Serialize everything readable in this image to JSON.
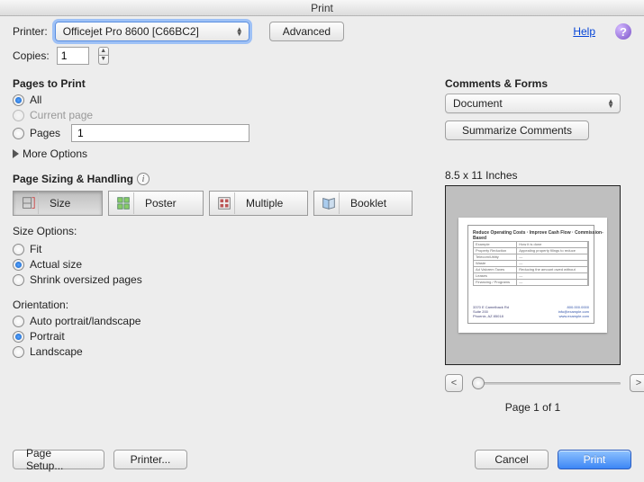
{
  "window": {
    "title": "Print"
  },
  "header": {
    "printer_label": "Printer:",
    "printer_value": "Officejet Pro 8600 [C66BC2]",
    "advanced_label": "Advanced",
    "help_link": "Help",
    "copies_label": "Copies:",
    "copies_value": "1"
  },
  "pages_to_print": {
    "heading": "Pages to Print",
    "options": {
      "all": "All",
      "current": "Current page",
      "pages": "Pages",
      "pages_value": "1"
    },
    "selected": "all",
    "more_options": "More Options"
  },
  "sizing": {
    "heading": "Page Sizing & Handling",
    "tabs": {
      "size": "Size",
      "poster": "Poster",
      "multiple": "Multiple",
      "booklet": "Booklet"
    },
    "selected_tab": "size",
    "size_options_label": "Size Options:",
    "options": {
      "fit": "Fit",
      "actual": "Actual size",
      "shrink": "Shrink oversized pages"
    },
    "selected_option": "actual"
  },
  "orientation": {
    "heading": "Orientation:",
    "options": {
      "auto": "Auto portrait/landscape",
      "portrait": "Portrait",
      "landscape": "Landscape"
    },
    "selected": "portrait"
  },
  "comments": {
    "heading": "Comments & Forms",
    "select_value": "Document",
    "summarize_label": "Summarize Comments"
  },
  "preview": {
    "dimensions": "8.5 x 11 Inches",
    "page_indicator": "Page 1 of 1"
  },
  "footer": {
    "page_setup": "Page Setup...",
    "printer_btn": "Printer...",
    "cancel": "Cancel",
    "print": "Print"
  }
}
